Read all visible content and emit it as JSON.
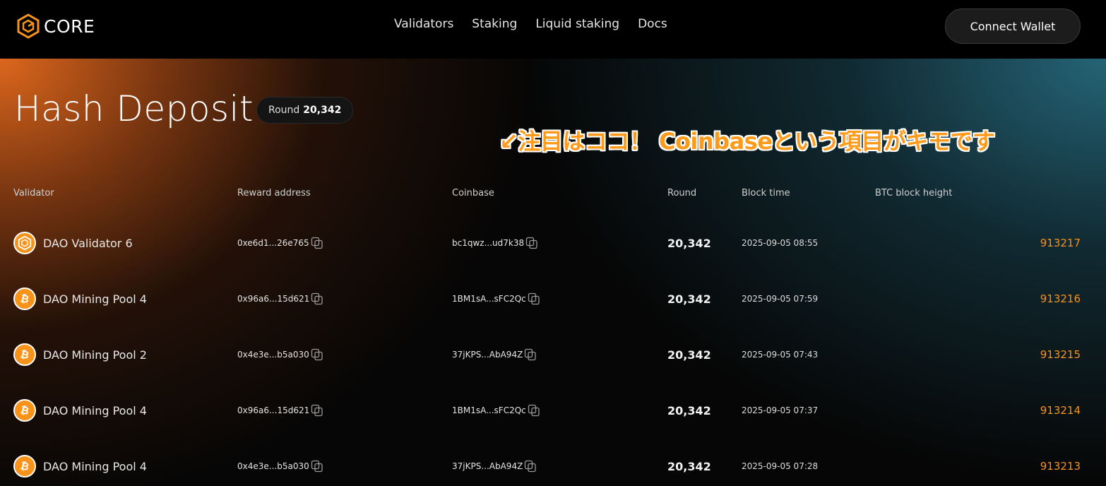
{
  "brand": {
    "name": "CORE",
    "accent": "#f7931a"
  },
  "nav": {
    "links": [
      "Validators",
      "Staking",
      "Liquid staking",
      "Docs"
    ],
    "connect_label": "Connect Wallet"
  },
  "page": {
    "title": "Hash Deposit",
    "round_label": "Round",
    "round_value": "20,342"
  },
  "annotation": "↙注目はココ！ Coinbaseという項目がキモです",
  "table": {
    "columns": [
      "Validator",
      "Reward address",
      "Coinbase",
      "Round",
      "Block time",
      "BTC block height"
    ],
    "rows": [
      {
        "icon": "core-icon",
        "validator": "DAO Validator 6",
        "reward": "0xe6d1...26e765",
        "coinbase": "bc1qwz...ud7k38",
        "round": "20,342",
        "time": "2025-09-05 08:55",
        "height": "913217"
      },
      {
        "icon": "bitcoin-icon",
        "validator": "DAO Mining Pool 4",
        "reward": "0x96a6...15d621",
        "coinbase": "1BM1sA...sFC2Qc",
        "round": "20,342",
        "time": "2025-09-05 07:59",
        "height": "913216"
      },
      {
        "icon": "bitcoin-icon",
        "validator": "DAO Mining Pool 2",
        "reward": "0x4e3e...b5a030",
        "coinbase": "37jKPS...AbA94Z",
        "round": "20,342",
        "time": "2025-09-05 07:43",
        "height": "913215"
      },
      {
        "icon": "bitcoin-icon",
        "validator": "DAO Mining Pool 4",
        "reward": "0x96a6...15d621",
        "coinbase": "1BM1sA...sFC2Qc",
        "round": "20,342",
        "time": "2025-09-05 07:37",
        "height": "913214"
      },
      {
        "icon": "bitcoin-icon",
        "validator": "DAO Mining Pool 4",
        "reward": "0x4e3e...b5a030",
        "coinbase": "37jKPS...AbA94Z",
        "round": "20,342",
        "time": "2025-09-05 07:28",
        "height": "913213"
      }
    ]
  }
}
